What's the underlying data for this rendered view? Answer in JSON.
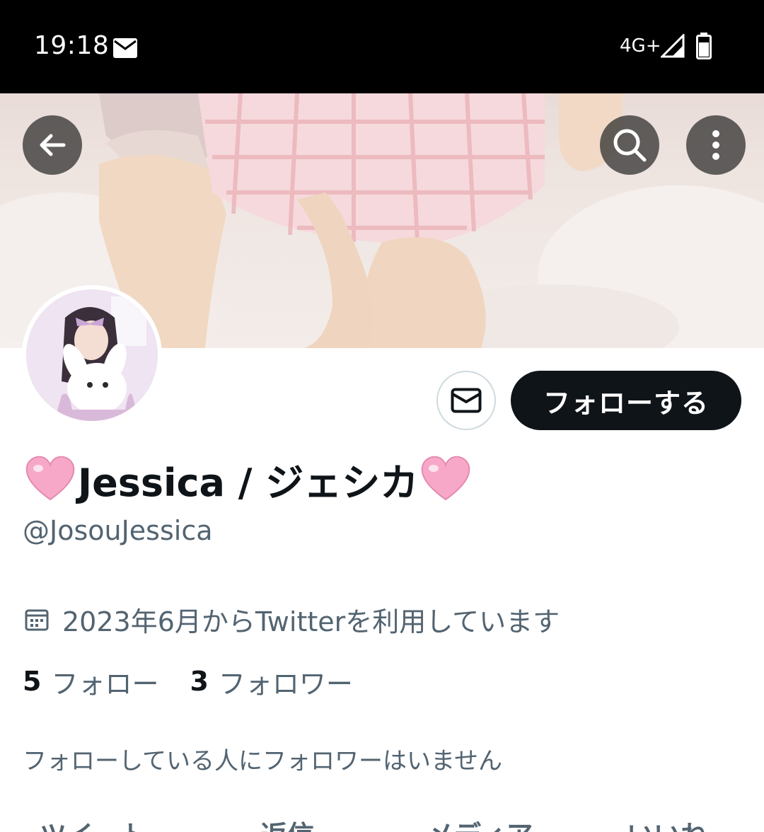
{
  "status_bar": {
    "time": "19:18",
    "network": "4G+",
    "icons": [
      "mail-icon",
      "signal-icon",
      "battery-icon"
    ]
  },
  "header": {
    "back_icon": "arrow-left-icon",
    "search_icon": "search-icon",
    "more_icon": "more-vertical-icon"
  },
  "actions": {
    "dm_icon": "envelope-icon",
    "follow_label": "フォローする"
  },
  "profile": {
    "name_text": "Jessica / ジェシカ",
    "name_emoji": "pink-heart",
    "handle": "@JosouJessica",
    "joined": "2023年6月からTwitterを利用しています",
    "following_count": "5",
    "following_label": "フォロー",
    "followers_count": "3",
    "followers_label": "フォロワー",
    "mutual_note": "フォローしている人にフォロワーはいません"
  },
  "tabs": [
    {
      "label": "ツイート"
    },
    {
      "label": "返信"
    },
    {
      "label": "メディア"
    },
    {
      "label": "いいね"
    }
  ],
  "colors": {
    "text_primary": "#0f1419",
    "text_secondary": "#536471",
    "follow_button": "#0f1419",
    "heart_pink": "#f7a8c8"
  }
}
